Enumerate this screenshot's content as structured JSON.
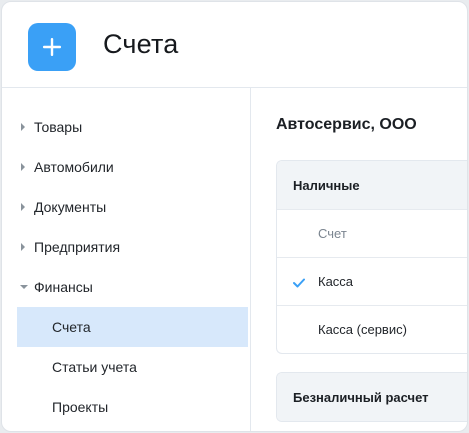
{
  "header": {
    "title": "Счета"
  },
  "sidebar": {
    "items": [
      {
        "label": "Товары"
      },
      {
        "label": "Автомобили"
      },
      {
        "label": "Документы"
      },
      {
        "label": "Предприятия"
      },
      {
        "label": "Финансы"
      },
      {
        "label": "Счета"
      },
      {
        "label": "Статьи учета"
      },
      {
        "label": "Проекты"
      }
    ]
  },
  "main": {
    "company": "Автосервис, ООО",
    "groups": [
      {
        "title": "Наличные",
        "column_header": "Счет",
        "rows": [
          {
            "label": "Касса",
            "checked": true
          },
          {
            "label": "Касса (сервис)",
            "checked": false
          }
        ]
      },
      {
        "title": "Безналичный расчет"
      }
    ]
  },
  "colors": {
    "accent": "#3aa0f6",
    "selected_bg": "#d7e8fb"
  }
}
